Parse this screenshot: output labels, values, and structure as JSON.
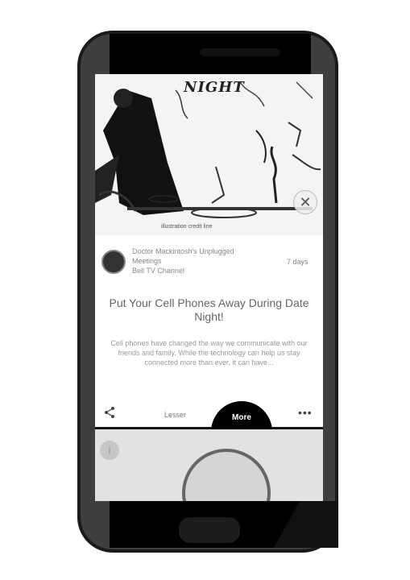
{
  "hero": {
    "title": "NIGHT",
    "caption": "illustration credit line",
    "close_icon": "close-icon"
  },
  "author": {
    "name_line": "Doctor Mackintosh's Unplugged",
    "name_line2": "Meetings",
    "handle": "Bell TV Channel",
    "time": "7 days"
  },
  "article": {
    "title": "Put Your Cell Phones Away During Date Night!",
    "body": "Cell phones have changed the way we communicate with our friends and family. While the technology can help us stay connected more than ever, it can have..."
  },
  "actions": {
    "share_icon": "share-icon",
    "secondary_label": "Lesser",
    "primary_label": "More",
    "more_icon": "ellipsis-icon"
  },
  "lower": {
    "badge": "i"
  }
}
